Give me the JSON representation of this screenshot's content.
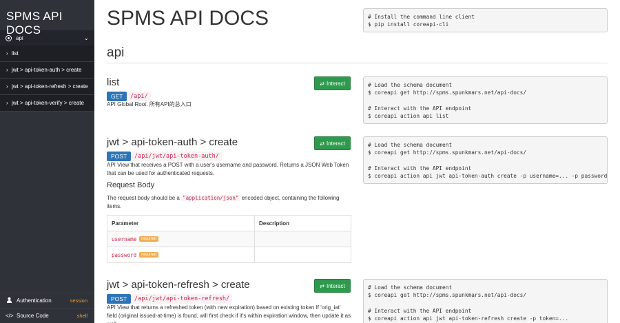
{
  "sidebar": {
    "brand": "SPMS API DOCS",
    "group_label": "api",
    "items": [
      {
        "label": "list"
      },
      {
        "label": "jwt > api-token-auth > create"
      },
      {
        "label": "jwt > api-token-refresh > create"
      },
      {
        "label": "jwt > api-token-verify > create"
      }
    ],
    "footer": {
      "auth_label": "Authentication",
      "auth_value": "session",
      "source_label": "Source Code",
      "source_value": "shell"
    }
  },
  "main": {
    "title": "SPMS API DOCS",
    "install_code": "# Install the command line client\n$ pip install coreapi-cli",
    "section": "api",
    "interact_label": "Interact",
    "endpoints": [
      {
        "title": "list",
        "method": "GET",
        "path": "/api/",
        "description": "API Global Root. 所有API的总入口",
        "code": "# Load the schema document\n$ coreapi get http://spms.spunkmars.net/api-docs/\n\n# Interact with the API endpoint\n$ coreapi action api list"
      },
      {
        "title": "jwt > api-token-auth > create",
        "method": "POST",
        "path": "/api/jwt/api-token-auth/",
        "description": "API View that receives a POST with a user's username and password. Returns a JSON Web Token that can be used for authenticated requests.",
        "request_body_heading": "Request Body",
        "request_body_pre": "The request body should be a",
        "request_body_code": "\"application/json\"",
        "request_body_post": "encoded object, containing the following items.",
        "table_headers": [
          "Parameter",
          "Description"
        ],
        "params": [
          {
            "name": "username",
            "badge": "required",
            "description": ""
          },
          {
            "name": "password",
            "badge": "required",
            "description": ""
          }
        ],
        "code": "# Load the schema document\n$ coreapi get http://spms.spunkmars.net/api-docs/\n\n# Interact with the API endpoint\n$ coreapi action api jwt api-token-auth create -p username=... -p password=..."
      },
      {
        "title": "jwt > api-token-refresh > create",
        "method": "POST",
        "path": "/api/jwt/api-token-refresh/",
        "description": "API View that returns a refreshed token (with new expiration) based on existing token If 'orig_iat' field (original issued-at-time) is found, will first check if it's within expiration window, then update it as well.",
        "code": "# Load the schema document\n$ coreapi get http://spms.spunkmars.net/api-docs/\n\n# Interact with the API endpoint\n$ coreapi action api jwt api-token-refresh create -p token=..."
      }
    ]
  }
}
